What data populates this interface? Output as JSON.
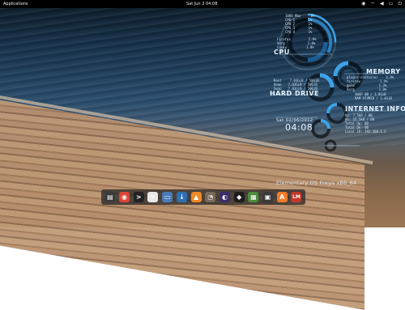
{
  "topbar": {
    "applications_label": "Applications",
    "clock": "Sat Jun  2   04:08"
  },
  "cpu": {
    "title": "CPU",
    "rows": [
      {
        "label": "1080 Mhz",
        "value": "0%"
      },
      {
        "label": "CPU 1",
        "value": "1%"
      },
      {
        "label": "CPU 2",
        "value": "1%"
      },
      {
        "label": "CPU 3",
        "value": "1%"
      },
      {
        "label": "CPU 4",
        "value": "1%"
      }
    ],
    "proc": [
      {
        "label": "Firefox",
        "value": "2.9%"
      },
      {
        "label": "Xorg",
        "value": "2.0%"
      },
      {
        "label": "Conky",
        "value": "1.8%"
      }
    ]
  },
  "memory": {
    "title": "MEMORY",
    "rows": [
      {
        "label": "plugin-container",
        "value": "4.9%"
      },
      {
        "label": "firefox",
        "value": "1.4%"
      },
      {
        "label": "gala",
        "value": "1.3%"
      },
      {
        "label": "Xorg",
        "value": "1.0%"
      }
    ],
    "swap_label": "SWAP",
    "swap_value": "0B / 1.9GiB",
    "ram_label": "RAM",
    "ram_value": "474MiB / 3.4GiB"
  },
  "hard_drive": {
    "title": "HARD DRIVE",
    "rows": [
      {
        "label": "Root",
        "value": "7.03GiB / 50GiB"
      },
      {
        "label": "Home",
        "value": "7.03GiB / 50GiB"
      },
      {
        "label": "Swap",
        "value": "7.03GiB / 50GiB"
      }
    ]
  },
  "clock_widget": {
    "date": "Sat 02/06/2012",
    "time": "04:08"
  },
  "internet": {
    "title": "INTERNET INFO",
    "rows": [
      "Up: 7.5kB / 0B",
      "Dn: 15.5kB / 0B",
      "Total Up: 0B",
      "Total Dn: 0B",
      "Local IP: 192.168.1.2"
    ]
  },
  "caption": "Elementary OS Freya x86_64",
  "dock": {
    "apps": [
      {
        "name": "files",
        "glyph": "▤",
        "color": "#3a3a3a"
      },
      {
        "name": "chrome",
        "glyph": "◉",
        "color": "#db4437"
      },
      {
        "name": "terminal",
        "glyph": ">",
        "color": "#222222"
      },
      {
        "name": "editor",
        "glyph": "✎",
        "color": "#e8e8e8"
      },
      {
        "name": "folder",
        "glyph": "▭",
        "color": "#4a7bb7"
      },
      {
        "name": "downloads",
        "glyph": "↓",
        "color": "#2f6fb2"
      },
      {
        "name": "vlc",
        "glyph": "▲",
        "color": "#f08a24"
      },
      {
        "name": "gimp",
        "glyph": "◔",
        "color": "#7a6a5a"
      },
      {
        "name": "eclipse",
        "glyph": "◐",
        "color": "#3b2e6a"
      },
      {
        "name": "inkscape",
        "glyph": "◆",
        "color": "#1d1d1d"
      },
      {
        "name": "system-monitor",
        "glyph": "▦",
        "color": "#4b8b3b"
      },
      {
        "name": "photos",
        "glyph": "▣",
        "color": "#3a3a3a"
      },
      {
        "name": "software-center",
        "glyph": "A",
        "color": "#f07a2a"
      },
      {
        "name": "unity-icon",
        "glyph": "LM",
        "color": "#c2382a"
      }
    ]
  }
}
